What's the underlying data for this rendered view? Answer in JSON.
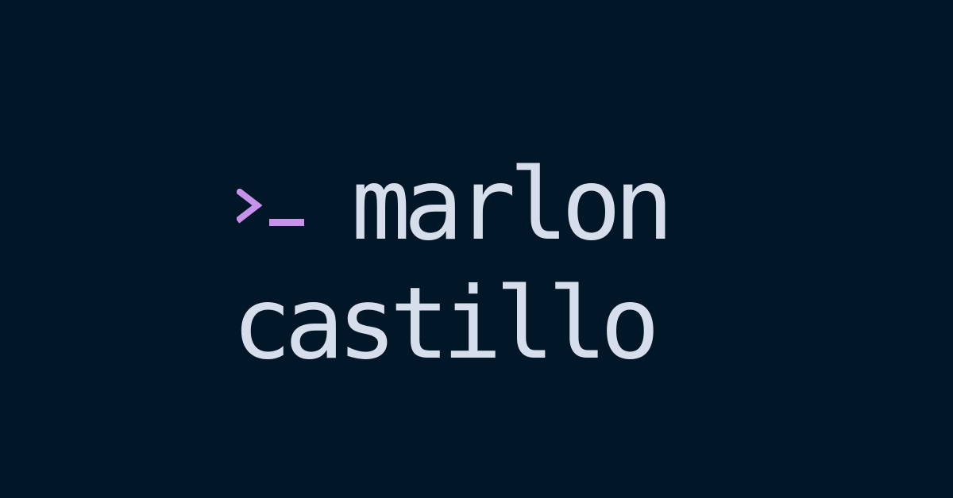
{
  "brand": {
    "first_name": "marlon",
    "last_name": "castillo"
  },
  "icons": {
    "prompt": "terminal-prompt-icon"
  },
  "colors": {
    "background": "#011627",
    "text": "#d6deeb",
    "accent": "#c792ea"
  }
}
